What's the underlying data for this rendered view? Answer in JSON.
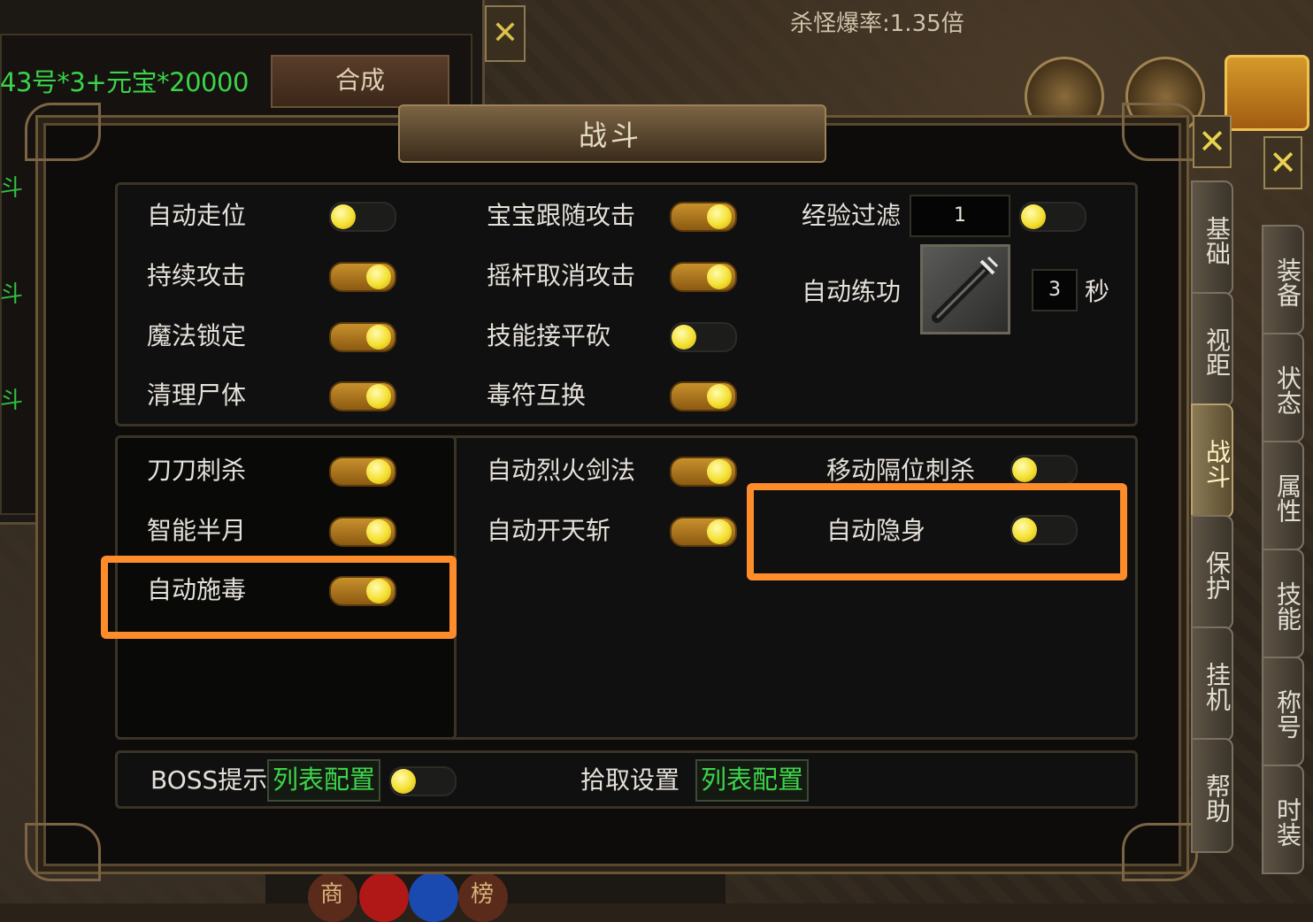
{
  "background": {
    "recipe_text": "43号*3+元宝*20000",
    "synth_button": "合成",
    "side_labels": [
      "斗",
      "斗",
      "斗"
    ],
    "drop_rate": "杀怪爆率:1.35倍",
    "bottom_labels": [
      "商",
      "榜"
    ]
  },
  "dialog": {
    "title": "战斗",
    "section1": {
      "col1": [
        {
          "label": "自动走位",
          "on": false
        },
        {
          "label": "持续攻击",
          "on": true
        },
        {
          "label": "魔法锁定",
          "on": true
        },
        {
          "label": "清理尸体",
          "on": true
        }
      ],
      "col2": [
        {
          "label": "宝宝跟随攻击",
          "on": true
        },
        {
          "label": "摇杆取消攻击",
          "on": true
        },
        {
          "label": "技能接平砍",
          "on": false
        },
        {
          "label": "毒符互换",
          "on": true
        }
      ],
      "exp_filter": {
        "label": "经验过滤",
        "value": "1",
        "on": false
      },
      "auto_practice": {
        "label": "自动练功",
        "value": "3",
        "unit": "秒"
      }
    },
    "section2": {
      "col1": [
        {
          "label": "刀刀刺杀",
          "on": true
        },
        {
          "label": "智能半月",
          "on": true
        },
        {
          "label": "自动施毒",
          "on": true
        }
      ],
      "col2": [
        {
          "label": "自动烈火剑法",
          "on": true
        },
        {
          "label": "自动开天斩",
          "on": true
        }
      ],
      "col3": [
        {
          "label": "移动隔位刺杀",
          "on": false
        },
        {
          "label": "自动隐身",
          "on": false
        }
      ]
    },
    "section3": {
      "boss_label": "BOSS提示",
      "boss_config": "列表配置",
      "boss_on": false,
      "pickup_label": "拾取设置",
      "pickup_config": "列表配置"
    },
    "highlight_color": "#ff8c2a"
  },
  "tabs_inner": [
    "基础",
    "视距",
    "战斗",
    "保护",
    "挂机",
    "帮助"
  ],
  "tabs_inner_active": "战斗",
  "tabs_outer": [
    "装备",
    "状态",
    "属性",
    "技能",
    "称号",
    "时装"
  ],
  "close_label": "✕"
}
